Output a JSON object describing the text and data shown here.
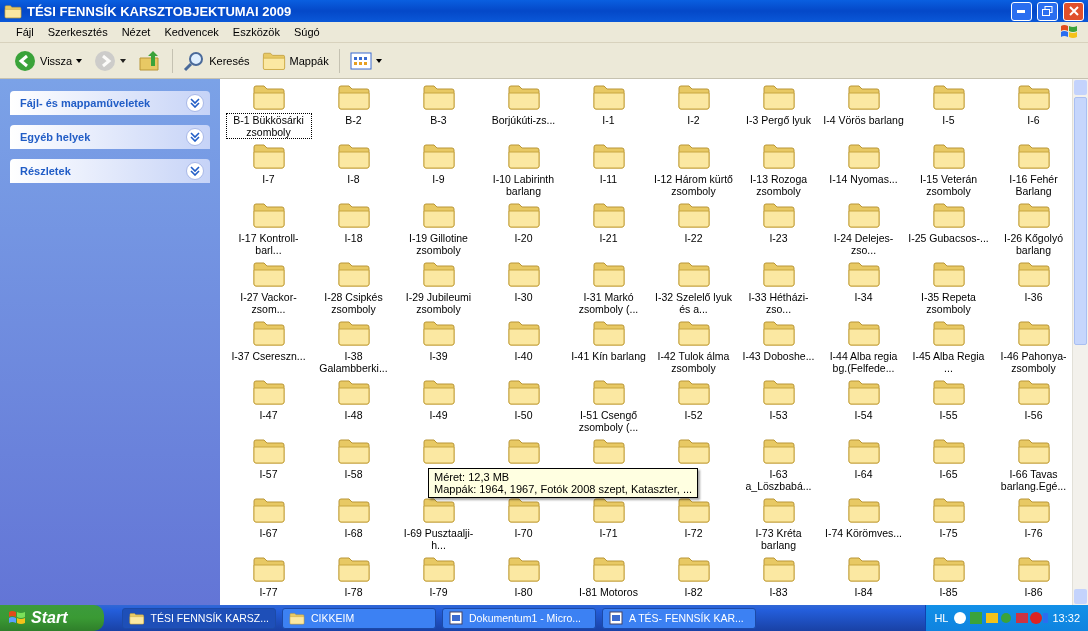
{
  "window": {
    "title": "TÉSI FENNSÍK KARSZTOBJEKTUMAI 2009"
  },
  "menu": [
    "Fájl",
    "Szerkesztés",
    "Nézet",
    "Kedvencek",
    "Eszközök",
    "Súgó"
  ],
  "toolbar": [
    {
      "kind": "back",
      "label": "Vissza",
      "disabled": false
    },
    {
      "kind": "forward",
      "disabled": true
    },
    {
      "kind": "up",
      "disabled": false
    },
    {
      "kind": "search",
      "label": "Keresés",
      "disabled": false
    },
    {
      "kind": "folders",
      "label": "Mappák",
      "disabled": false
    },
    {
      "kind": "views",
      "disabled": false
    }
  ],
  "sidebar": {
    "panels": [
      {
        "title": "Fájl- és mappaműveletek",
        "expanded": false
      },
      {
        "title": "Egyéb helyek",
        "expanded": false
      },
      {
        "title": "Részletek",
        "expanded": false
      }
    ]
  },
  "items": [
    {
      "label": "B-1 Bükkösárki zsomboly",
      "focused": true
    },
    {
      "label": "B-2",
      "focused": false
    },
    {
      "label": "B-3",
      "focused": false
    },
    {
      "label": "Borjúkúti-zs...",
      "focused": false
    },
    {
      "label": "I-1",
      "focused": false
    },
    {
      "label": "I-2",
      "focused": false
    },
    {
      "label": "I-3 Pergő lyuk",
      "focused": false
    },
    {
      "label": "I-4 Vörös barlang",
      "focused": false
    },
    {
      "label": "I-5",
      "focused": false
    },
    {
      "label": "I-6",
      "focused": false
    },
    {
      "label": "I-7",
      "focused": false
    },
    {
      "label": "I-8",
      "focused": false
    },
    {
      "label": "I-9",
      "focused": false
    },
    {
      "label": "I-10 Labirinth barlang",
      "focused": false
    },
    {
      "label": "I-11",
      "focused": false
    },
    {
      "label": "I-12 Három kürtő zsomboly",
      "focused": false
    },
    {
      "label": "I-13 Rozoga zsomboly",
      "focused": false
    },
    {
      "label": "I-14 Nyomas...",
      "focused": false
    },
    {
      "label": "I-15 Veterán zsomboly",
      "focused": false
    },
    {
      "label": "I-16 Fehér Barlang",
      "focused": false
    },
    {
      "label": "I-17 Kontroll-barl...",
      "focused": false
    },
    {
      "label": "I-18",
      "focused": false
    },
    {
      "label": "I-19 Gillotine zsomboly",
      "focused": false
    },
    {
      "label": "I-20",
      "focused": false
    },
    {
      "label": "I-21",
      "focused": false
    },
    {
      "label": "I-22",
      "focused": false
    },
    {
      "label": "I-23",
      "focused": false
    },
    {
      "label": "I-24 Delejes-zso...",
      "focused": false
    },
    {
      "label": "I-25 Gubacsos-...",
      "focused": false
    },
    {
      "label": "I-26 Kőgolyó barlang",
      "focused": false
    },
    {
      "label": "I-27 Vackor-zsom...",
      "focused": false
    },
    {
      "label": "I-28 Csipkés zsomboly",
      "focused": false
    },
    {
      "label": "I-29 Jubileumi zsomboly",
      "focused": false
    },
    {
      "label": "I-30",
      "focused": false
    },
    {
      "label": "I-31 Markó zsomboly (...",
      "focused": false
    },
    {
      "label": "I-32 Szelelő lyuk és a...",
      "focused": false
    },
    {
      "label": "I-33 Hétházi-zso...",
      "focused": false
    },
    {
      "label": "I-34",
      "focused": false
    },
    {
      "label": "I-35 Repeta zsomboly",
      "focused": false
    },
    {
      "label": "I-36",
      "focused": false
    },
    {
      "label": "I-37 Csereszn...",
      "focused": false
    },
    {
      "label": "I-38 Galambberki...",
      "focused": false
    },
    {
      "label": "I-39",
      "focused": false
    },
    {
      "label": "I-40",
      "focused": false
    },
    {
      "label": "I-41 Kín barlang",
      "focused": false
    },
    {
      "label": "I-42 Tulok álma zsomboly",
      "focused": false
    },
    {
      "label": "I-43 Doboshe...",
      "focused": false
    },
    {
      "label": "I-44 Alba regia bg.(Felfede...",
      "focused": false
    },
    {
      "label": "I-45 Alba Regia ...",
      "focused": false
    },
    {
      "label": "I-46 Pahonya-zsomboly",
      "focused": false
    },
    {
      "label": "I-47",
      "focused": false
    },
    {
      "label": "I-48",
      "focused": false
    },
    {
      "label": "I-49",
      "focused": false
    },
    {
      "label": "I-50",
      "focused": false
    },
    {
      "label": "I-51 Csengő zsomboly (...",
      "focused": false
    },
    {
      "label": "I-52",
      "focused": false
    },
    {
      "label": "I-53",
      "focused": false
    },
    {
      "label": "I-54",
      "focused": false
    },
    {
      "label": "I-55",
      "focused": false
    },
    {
      "label": "I-56",
      "focused": false
    },
    {
      "label": "I-57",
      "focused": false
    },
    {
      "label": "I-58",
      "focused": false
    },
    {
      "focused": false
    },
    {
      "focused": false
    },
    {
      "focused": false
    },
    {
      "focused": false
    },
    {
      "label": "I-63 a_Löszbabá...",
      "focused": false
    },
    {
      "label": "I-64",
      "focused": false
    },
    {
      "label": "I-65",
      "focused": false
    },
    {
      "label": "I-66 Tavas barlang.Egé...",
      "focused": false
    },
    {
      "label": "I-67",
      "focused": false
    },
    {
      "label": "I-68",
      "focused": false
    },
    {
      "label": "I-69 Pusztaalji-h...",
      "focused": false
    },
    {
      "label": "I-70",
      "focused": false
    },
    {
      "label": "I-71",
      "focused": false
    },
    {
      "label": "I-72",
      "focused": false
    },
    {
      "label": "I-73 Kréta barlang",
      "focused": false
    },
    {
      "label": "I-74 Körömves...",
      "focused": false
    },
    {
      "label": "I-75",
      "focused": false
    },
    {
      "label": "I-76",
      "focused": false
    },
    {
      "label": "I-77",
      "focused": false
    },
    {
      "label": "I-78",
      "focused": false
    },
    {
      "label": "I-79",
      "focused": false
    },
    {
      "label": "I-80",
      "focused": false
    },
    {
      "label": "I-81 Motoros",
      "focused": false
    },
    {
      "label": "I-82",
      "focused": false
    },
    {
      "label": "I-83",
      "focused": false
    },
    {
      "label": "I-84",
      "focused": false
    },
    {
      "label": "I-85",
      "focused": false
    },
    {
      "label": "I-86",
      "focused": false
    }
  ],
  "tooltip": {
    "lines": [
      "Méret: 12,3 MB",
      "Mappák: 1964, 1967, Fotók 2008 szept, Kataszter, ..."
    ]
  },
  "taskbar": {
    "start": "Start",
    "tasks": [
      {
        "label": "TÉSI FENNSÍK KARSZ...",
        "kind": "folder",
        "selected": true
      },
      {
        "label": "CIKKEIM",
        "kind": "folder",
        "selected": false
      },
      {
        "label": "Dokumentum1 - Micro...",
        "kind": "document",
        "selected": false
      },
      {
        "label": "A TÉS- FENNSÍK KAR...",
        "kind": "document",
        "selected": false
      }
    ],
    "tray": {
      "language": "HL",
      "clock": "13:32"
    }
  }
}
